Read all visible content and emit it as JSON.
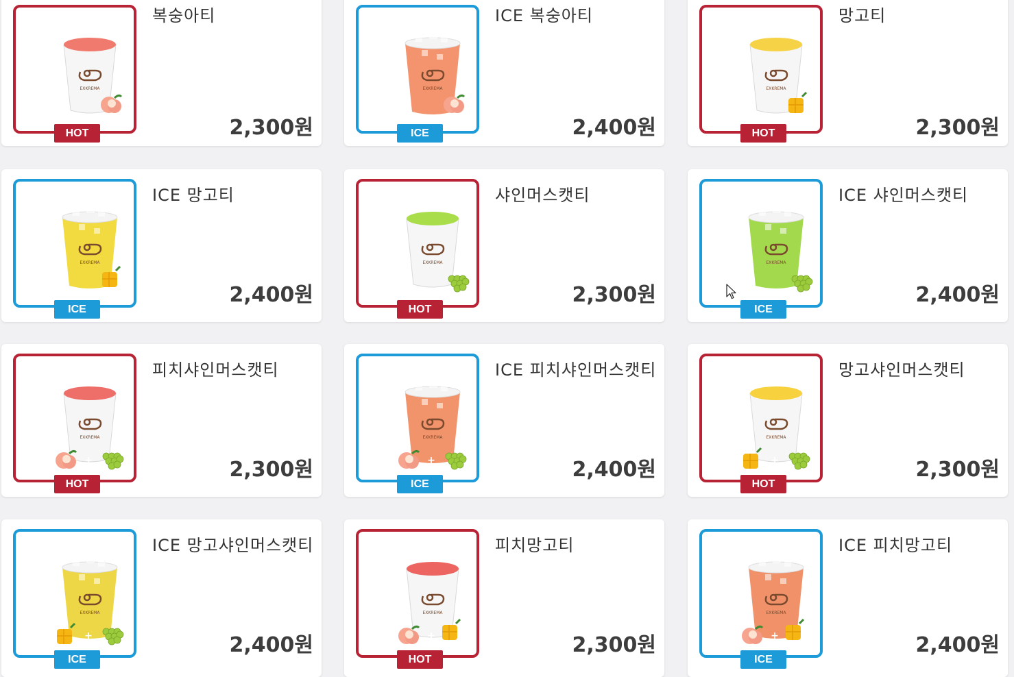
{
  "menu_items": [
    {
      "name": "복숭아티",
      "price": "2,300원",
      "temp": "HOT",
      "liquid": "#f07a6e",
      "fruits": [
        "peach"
      ]
    },
    {
      "name": "ICE 복숭아티",
      "price": "2,400원",
      "temp": "ICE",
      "liquid": "#f28b62",
      "fruits": [
        "peach"
      ]
    },
    {
      "name": "망고티",
      "price": "2,300원",
      "temp": "HOT",
      "liquid": "#f6d246",
      "fruits": [
        "mango"
      ]
    },
    {
      "name": "ICE 망고티",
      "price": "2,400원",
      "temp": "ICE",
      "liquid": "#f0d830",
      "fruits": [
        "mango"
      ]
    },
    {
      "name": "샤인머스캣티",
      "price": "2,300원",
      "temp": "HOT",
      "liquid": "#a9dd4a",
      "fruits": [
        "grape"
      ]
    },
    {
      "name": "ICE 샤인머스캣티",
      "price": "2,400원",
      "temp": "ICE",
      "liquid": "#9bd63d",
      "fruits": [
        "grape"
      ]
    },
    {
      "name": "피치샤인머스캣티",
      "price": "2,300원",
      "temp": "HOT",
      "liquid": "#ee6f6a",
      "fruits": [
        "peach",
        "grape"
      ]
    },
    {
      "name": "ICE 피치샤인머스캣티",
      "price": "2,400원",
      "temp": "ICE",
      "liquid": "#f08a5e",
      "fruits": [
        "peach",
        "grape"
      ]
    },
    {
      "name": "망고샤인머스캣티",
      "price": "2,300원",
      "temp": "HOT",
      "liquid": "#f7d23e",
      "fruits": [
        "mango",
        "grape"
      ]
    },
    {
      "name": "ICE 망고샤인머스캣티",
      "price": "2,400원",
      "temp": "ICE",
      "liquid": "#ecd436",
      "fruits": [
        "mango",
        "grape"
      ]
    },
    {
      "name": "피치망고티",
      "price": "2,300원",
      "temp": "HOT",
      "liquid": "#ec6561",
      "fruits": [
        "peach",
        "mango"
      ]
    },
    {
      "name": "ICE 피치망고티",
      "price": "2,400원",
      "temp": "ICE",
      "liquid": "#f0885c",
      "fruits": [
        "peach",
        "mango"
      ]
    }
  ],
  "colors": {
    "hot": "#b82235",
    "ice": "#1d9ad8"
  },
  "icons": {
    "cursor": "mouse-pointer-icon",
    "cup": "drink-cup-icon"
  }
}
